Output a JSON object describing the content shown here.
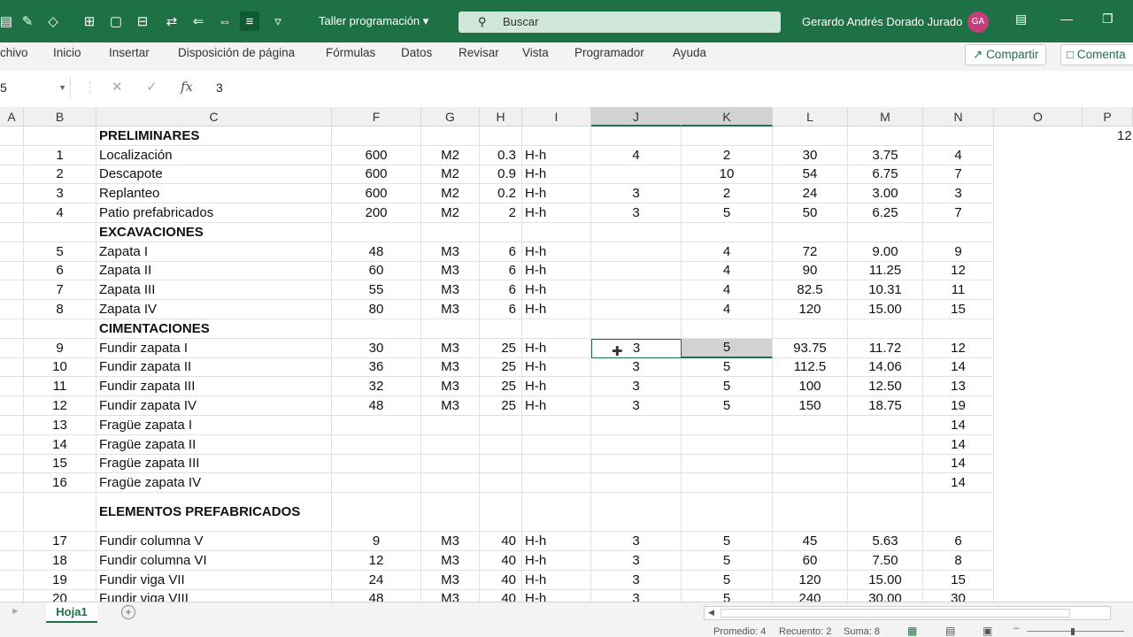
{
  "titlebar": {
    "doc_title": "Taller programación",
    "doc_chevron": "▾",
    "search_placeholder": "Buscar",
    "user_name": "Gerardo Andrés Dorado Jurado",
    "avatar": "GA",
    "icons": [
      "table-icon",
      "brush-icon",
      "eraser-icon",
      "borders-icon",
      "border-icon",
      "merge-icon",
      "transpose-icon",
      "align-icon",
      "distribute-icon",
      "wrap-icon",
      "customize-icon"
    ]
  },
  "menu": {
    "items": [
      "chivo",
      "Inicio",
      "Insertar",
      "Disposición de página",
      "Fórmulas",
      "Datos",
      "Revisar",
      "Vista",
      "Programador",
      "Ayuda"
    ],
    "share": "Compartir",
    "comments": "Comenta"
  },
  "formula_bar": {
    "name_box": "5",
    "value": "3",
    "fx": "fx"
  },
  "columns": [
    "A",
    "B",
    "C",
    "F",
    "G",
    "H",
    "I",
    "J",
    "K",
    "L",
    "M",
    "N",
    "O",
    "P"
  ],
  "rows": [
    {
      "b": "",
      "c": "PRELIMINARES",
      "f": "",
      "g": "",
      "h": "",
      "i": "",
      "j": "",
      "k": "",
      "l": "",
      "m": "",
      "n": "",
      "p": "12",
      "bold": true
    },
    {
      "b": "1",
      "c": "Localización",
      "f": "600",
      "g": "M2",
      "h": "0.3",
      "i": "H-h",
      "j": "4",
      "k": "2",
      "l": "30",
      "m": "3.75",
      "n": "4"
    },
    {
      "b": "2",
      "c": "Descapote",
      "f": "600",
      "g": "M2",
      "h": "0.9",
      "i": "H-h",
      "j": "",
      "k": "10",
      "l": "54",
      "m": "6.75",
      "n": "7"
    },
    {
      "b": "3",
      "c": "Replanteo",
      "f": "600",
      "g": "M2",
      "h": "0.2",
      "i": "H-h",
      "j": "3",
      "k": "2",
      "l": "24",
      "m": "3.00",
      "n": "3"
    },
    {
      "b": "4",
      "c": "Patio prefabricados",
      "f": "200",
      "g": "M2",
      "h": "2",
      "i": "H-h",
      "j": "3",
      "k": "5",
      "l": "50",
      "m": "6.25",
      "n": "7"
    },
    {
      "b": "",
      "c": "EXCAVACIONES",
      "f": "",
      "g": "",
      "h": "",
      "i": "",
      "j": "",
      "k": "",
      "l": "",
      "m": "",
      "n": "",
      "bold": true
    },
    {
      "b": "5",
      "c": "Zapata I",
      "f": "48",
      "g": "M3",
      "h": "6",
      "i": "H-h",
      "j": "",
      "k": "4",
      "l": "72",
      "m": "9.00",
      "n": "9"
    },
    {
      "b": "6",
      "c": "Zapata II",
      "f": "60",
      "g": "M3",
      "h": "6",
      "i": "H-h",
      "j": "",
      "k": "4",
      "l": "90",
      "m": "11.25",
      "n": "12"
    },
    {
      "b": "7",
      "c": "Zapata III",
      "f": "55",
      "g": "M3",
      "h": "6",
      "i": "H-h",
      "j": "",
      "k": "4",
      "l": "82.5",
      "m": "10.31",
      "n": "11"
    },
    {
      "b": "8",
      "c": "Zapata IV",
      "f": "80",
      "g": "M3",
      "h": "6",
      "i": "H-h",
      "j": "",
      "k": "4",
      "l": "120",
      "m": "15.00",
      "n": "15"
    },
    {
      "b": "",
      "c": "CIMENTACIONES",
      "f": "",
      "g": "",
      "h": "",
      "i": "",
      "j": "",
      "k": "",
      "l": "",
      "m": "",
      "n": "",
      "bold": true
    },
    {
      "b": "9",
      "c": "Fundir zapata I",
      "f": "30",
      "g": "M3",
      "h": "25",
      "i": "H-h",
      "j": "3",
      "k": "5",
      "l": "93.75",
      "m": "11.72",
      "n": "12",
      "selected": true
    },
    {
      "b": "10",
      "c": "Fundir zapata II",
      "f": "36",
      "g": "M3",
      "h": "25",
      "i": "H-h",
      "j": "3",
      "k": "5",
      "l": "112.5",
      "m": "14.06",
      "n": "14"
    },
    {
      "b": "11",
      "c": "Fundir zapata III",
      "f": "32",
      "g": "M3",
      "h": "25",
      "i": "H-h",
      "j": "3",
      "k": "5",
      "l": "100",
      "m": "12.50",
      "n": "13"
    },
    {
      "b": "12",
      "c": "Fundir zapata IV",
      "f": "48",
      "g": "M3",
      "h": "25",
      "i": "H-h",
      "j": "3",
      "k": "5",
      "l": "150",
      "m": "18.75",
      "n": "19"
    },
    {
      "b": "13",
      "c": "Fragüe zapata I",
      "f": "",
      "g": "",
      "h": "",
      "i": "",
      "j": "",
      "k": "",
      "l": "",
      "m": "",
      "n": "14"
    },
    {
      "b": "14",
      "c": "Fragüe zapata II",
      "f": "",
      "g": "",
      "h": "",
      "i": "",
      "j": "",
      "k": "",
      "l": "",
      "m": "",
      "n": "14"
    },
    {
      "b": "15",
      "c": "Fragüe zapata III",
      "f": "",
      "g": "",
      "h": "",
      "i": "",
      "j": "",
      "k": "",
      "l": "",
      "m": "",
      "n": "14"
    },
    {
      "b": "16",
      "c": "Fragüe zapata IV",
      "f": "",
      "g": "",
      "h": "",
      "i": "",
      "j": "",
      "k": "",
      "l": "",
      "m": "",
      "n": "14"
    },
    {
      "b": "",
      "c": "ELEMENTOS PREFABRICADOS",
      "f": "",
      "g": "",
      "h": "",
      "i": "",
      "j": "",
      "k": "",
      "l": "",
      "m": "",
      "n": "",
      "bold": true,
      "tall": true
    },
    {
      "b": "17",
      "c": "Fundir columna V",
      "f": "9",
      "g": "M3",
      "h": "40",
      "i": "H-h",
      "j": "3",
      "k": "5",
      "l": "45",
      "m": "5.63",
      "n": "6"
    },
    {
      "b": "18",
      "c": "Fundir columna VI",
      "f": "12",
      "g": "M3",
      "h": "40",
      "i": "H-h",
      "j": "3",
      "k": "5",
      "l": "60",
      "m": "7.50",
      "n": "8"
    },
    {
      "b": "19",
      "c": "Fundir viga VII",
      "f": "24",
      "g": "M3",
      "h": "40",
      "i": "H-h",
      "j": "3",
      "k": "5",
      "l": "120",
      "m": "15.00",
      "n": "15"
    },
    {
      "b": "20",
      "c": "Fundir viga VIII",
      "f": "48",
      "g": "M3",
      "h": "40",
      "i": "H-h",
      "j": "3",
      "k": "5",
      "l": "240",
      "m": "30.00",
      "n": "30"
    }
  ],
  "sheet": {
    "tab": "Hoja1",
    "add": "+"
  },
  "status": {
    "promedio": "Promedio: 4",
    "recuento": "Recuento: 2",
    "suma": "Suma: 8"
  },
  "colors": {
    "accent": "#1e7145",
    "selected_fill": "#d2d2d2"
  }
}
